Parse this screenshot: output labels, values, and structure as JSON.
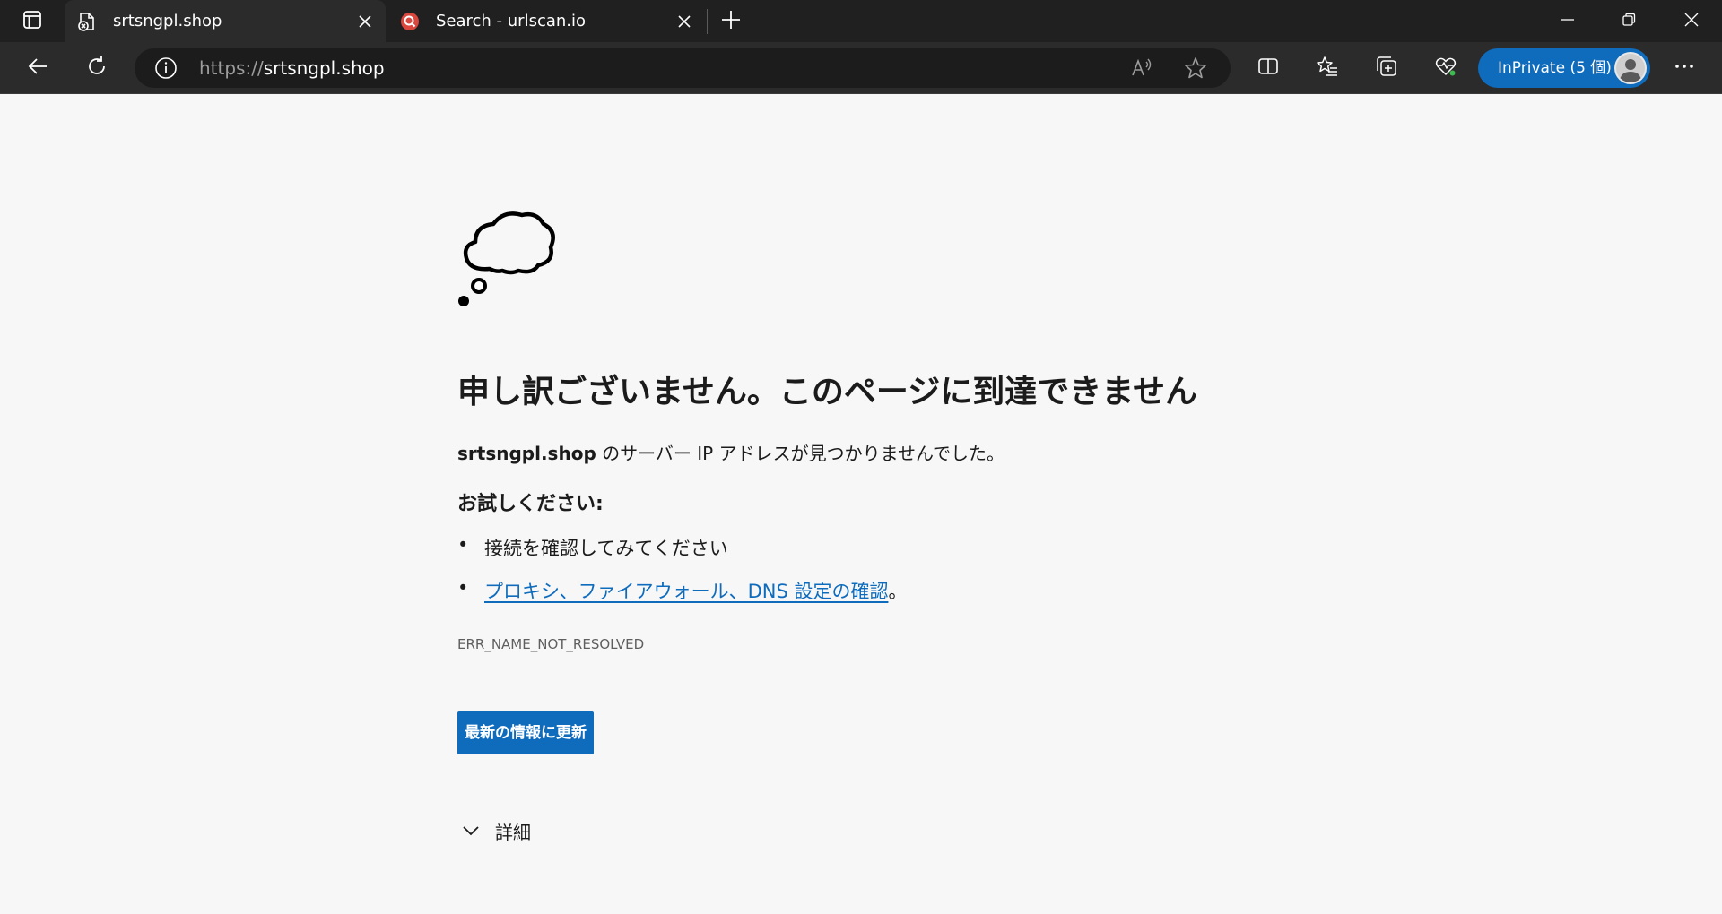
{
  "tabs": [
    {
      "title": "srtsngpl.shop",
      "favicon": "page-error-icon",
      "active": true
    },
    {
      "title": "Search - urlscan.io",
      "favicon": "urlscan-logo-icon",
      "active": false
    }
  ],
  "address_bar": {
    "protocol": "https://",
    "host": "srtsngpl.shop"
  },
  "profile": {
    "inprivate_label": "InPrivate (5 個)"
  },
  "error_page": {
    "headline": "申し訳ございません。このページに到達できません",
    "host": "srtsngpl.shop",
    "summary_rest": " のサーバー IP アドレスが見つかりませんでした。",
    "try_heading": "お試しください:",
    "suggestions": [
      {
        "text": "接続を確認してみてください",
        "is_link": false
      },
      {
        "text": "プロキシ、ファイアウォール、DNS 設定の確認",
        "trail": "。",
        "is_link": true
      }
    ],
    "error_code": "ERR_NAME_NOT_RESOLVED",
    "refresh_button": "最新の情報に更新",
    "details_label": "詳細"
  },
  "colors": {
    "accent": "#0f6cbd",
    "tabstrip_bg": "#202020",
    "toolbar_bg": "#2b2b2b",
    "page_bg": "#f7f7f7"
  }
}
